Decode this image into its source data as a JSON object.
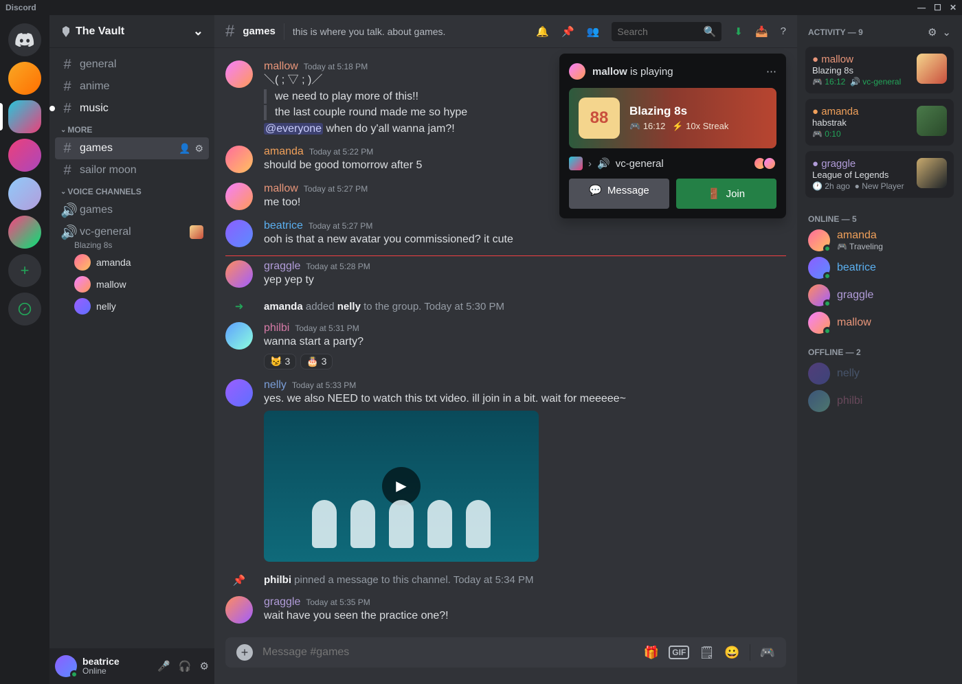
{
  "app": {
    "title": "Discord"
  },
  "server": {
    "name": "The Vault"
  },
  "channelGroups": [
    {
      "name": null,
      "channels": [
        {
          "id": "general",
          "label": "general",
          "type": "text"
        },
        {
          "id": "anime",
          "label": "anime",
          "type": "text"
        },
        {
          "id": "music",
          "label": "music",
          "type": "text",
          "notify": true
        }
      ]
    },
    {
      "name": "MORE",
      "channels": [
        {
          "id": "games",
          "label": "games",
          "type": "text",
          "selected": true
        },
        {
          "id": "sailor-moon",
          "label": "sailor moon",
          "type": "text"
        }
      ]
    },
    {
      "name": "VOICE CHANNELS",
      "channels": [
        {
          "id": "v-games",
          "label": "games",
          "type": "voice"
        },
        {
          "id": "vc-general",
          "label": "vc-general",
          "type": "voice",
          "activity": "Blazing 8s",
          "users": [
            {
              "name": "amanda",
              "av": "av-amanda"
            },
            {
              "name": "mallow",
              "av": "av-mallow"
            },
            {
              "name": "nelly",
              "av": "av-nelly"
            }
          ]
        }
      ]
    }
  ],
  "currentUser": {
    "name": "beatrice",
    "status": "Online",
    "av": "av-beatrice"
  },
  "header": {
    "channel": "games",
    "topic": "this is where you talk. about games.",
    "searchPlaceholder": "Search"
  },
  "activityPopup": {
    "user": "mallow",
    "verb": "is playing",
    "game": "Blazing 8s",
    "time": "16:12",
    "streak": "10x Streak",
    "vc": "vc-general",
    "messageLabel": "Message",
    "joinLabel": "Join"
  },
  "input": {
    "placeholder": "Message #games"
  },
  "membersPanel": {
    "activityHeader": "ACTIVITY — 9",
    "activities": [
      {
        "name": "mallow",
        "colorClass": "c-mallow",
        "game": "Blazing 8s",
        "meta": "16:12",
        "metaExtra": "vc-general",
        "metaClass": "",
        "thumb": "linear-gradient(135deg,#f4d58d,#c94f3d)"
      },
      {
        "name": "amanda",
        "colorClass": "c-amanda",
        "game": "habstrak",
        "meta": "0:10",
        "metaClass": "",
        "thumb": "linear-gradient(135deg,#4a7a4a,#2a4a2a)"
      },
      {
        "name": "graggle",
        "colorClass": "c-graggle",
        "game": "League of Legends",
        "meta": "2h ago",
        "metaExtra": "New Player",
        "metaClass": "grey",
        "thumb": "linear-gradient(135deg,#c8aa6e,#1e2328)"
      }
    ],
    "onlineHeader": "ONLINE — 5",
    "online": [
      {
        "name": "amanda",
        "colorClass": "c-amanda",
        "av": "av-amanda",
        "status": "Traveling",
        "dot": "#23a559"
      },
      {
        "name": "beatrice",
        "colorClass": "c-beatrice",
        "av": "av-beatrice",
        "dot": "#23a559"
      },
      {
        "name": "graggle",
        "colorClass": "c-graggle",
        "av": "av-graggle",
        "dot": "#23a559"
      },
      {
        "name": "mallow",
        "colorClass": "c-mallow",
        "av": "av-mallow",
        "dot": "#23a559"
      }
    ],
    "offlineHeader": "OFFLINE — 2",
    "offline": [
      {
        "name": "nelly",
        "colorClass": "c-nelly",
        "av": "av-nelly"
      },
      {
        "name": "philbi",
        "colorClass": "c-philbi",
        "av": "av-philbi"
      }
    ]
  },
  "messages": [
    {
      "type": "msg",
      "user": "mallow",
      "colorClass": "c-mallow",
      "av": "av-mallow",
      "ts": "Today at 5:18 PM",
      "lines": [
        "＼( ; ▽ ; )／"
      ],
      "quoted": [
        "we need to play more of this!!",
        "the last couple round made me so hype"
      ],
      "after": "<span class='mention'>@everyone</span> when do y'all wanna jam?!"
    },
    {
      "type": "msg",
      "user": "amanda",
      "colorClass": "c-amanda",
      "av": "av-amanda",
      "ts": "Today at 5:22 PM",
      "lines": [
        "should be good tomorrow after 5"
      ]
    },
    {
      "type": "msg",
      "user": "mallow",
      "colorClass": "c-mallow",
      "av": "av-mallow",
      "ts": "Today at 5:27 PM",
      "lines": [
        "me too!"
      ]
    },
    {
      "type": "msg",
      "user": "beatrice",
      "colorClass": "c-beatrice",
      "av": "av-beatrice",
      "ts": "Today at 5:27 PM",
      "lines": [
        "ooh is that a new avatar you commissioned? it cute"
      ]
    },
    {
      "type": "divider"
    },
    {
      "type": "msg",
      "user": "graggle",
      "colorClass": "c-graggle",
      "av": "av-graggle",
      "ts": "Today at 5:28 PM",
      "lines": [
        "yep yep ty"
      ]
    },
    {
      "type": "sys",
      "icon": "add",
      "html": "<b style='color:#f2f3f5'>amanda</b> added <b style='color:#f2f3f5'>nelly</b> to the group.",
      "ts": "Today at 5:30 PM"
    },
    {
      "type": "msg",
      "user": "philbi",
      "colorClass": "c-philbi",
      "av": "av-philbi",
      "ts": "Today at 5:31 PM",
      "lines": [
        "wanna start a party?"
      ],
      "reactions": [
        {
          "emoji": "😼",
          "count": 3
        },
        {
          "emoji": "🎂",
          "count": 3
        }
      ]
    },
    {
      "type": "msg",
      "user": "nelly",
      "colorClass": "c-nelly",
      "av": "av-nelly",
      "ts": "Today at 5:33 PM",
      "lines": [
        "yes. we also NEED to watch this txt video. ill join in a bit. wait for meeeee~"
      ],
      "embed": "video"
    },
    {
      "type": "sys",
      "icon": "pin",
      "html": "<b style='color:#f2f3f5'>philbi</b> pinned a message to this channel.",
      "ts": "Today at 5:34 PM"
    },
    {
      "type": "msg",
      "user": "graggle",
      "colorClass": "c-graggle",
      "av": "av-graggle",
      "ts": "Today at 5:35 PM",
      "lines": [
        "wait have you seen the practice one?!"
      ]
    }
  ]
}
